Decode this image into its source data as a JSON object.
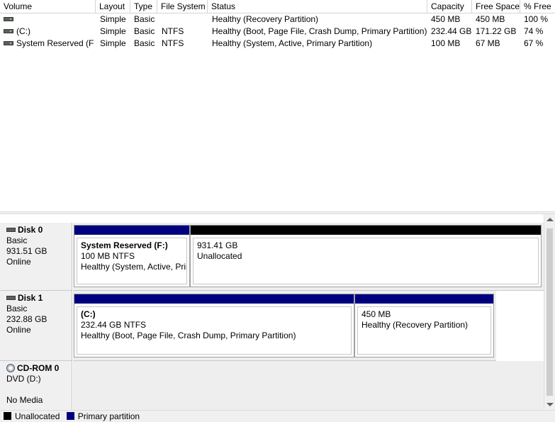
{
  "volume_list": {
    "columns": [
      "Volume",
      "Layout",
      "Type",
      "File System",
      "Status",
      "Capacity",
      "Free Space",
      "% Free"
    ],
    "rows": [
      {
        "volume": "",
        "layout": "Simple",
        "type": "Basic",
        "fs": "",
        "status": "Healthy (Recovery Partition)",
        "capacity": "450 MB",
        "free": "450 MB",
        "pct": "100 %"
      },
      {
        "volume": "(C:)",
        "layout": "Simple",
        "type": "Basic",
        "fs": "NTFS",
        "status": "Healthy (Boot, Page File, Crash Dump, Primary Partition)",
        "capacity": "232.44 GB",
        "free": "171.22 GB",
        "pct": "74 %"
      },
      {
        "volume": "System Reserved (F:)",
        "layout": "Simple",
        "type": "Basic",
        "fs": "NTFS",
        "status": "Healthy (System, Active, Primary Partition)",
        "capacity": "100 MB",
        "free": "67 MB",
        "pct": "67 %"
      }
    ]
  },
  "disks": [
    {
      "name": "Disk 0",
      "kind": "Basic",
      "size": "931.51 GB",
      "state": "Online",
      "partitions": [
        {
          "title": "System Reserved  (F:)",
          "size_fs": "100 MB NTFS",
          "status": "Healthy (System, Active, Primary Partition)",
          "type": "primary"
        },
        {
          "title": "",
          "size_fs": "931.41 GB",
          "status": "Unallocated",
          "type": "unallocated"
        }
      ]
    },
    {
      "name": "Disk 1",
      "kind": "Basic",
      "size": "232.88 GB",
      "state": "Online",
      "partitions": [
        {
          "title": "(C:)",
          "size_fs": "232.44 GB NTFS",
          "status": "Healthy (Boot, Page File, Crash Dump, Primary Partition)",
          "type": "primary"
        },
        {
          "title": "",
          "size_fs": "450 MB",
          "status": "Healthy (Recovery Partition)",
          "type": "primary"
        }
      ]
    },
    {
      "name": "CD-ROM 0",
      "kind": "DVD (D:)",
      "size": "",
      "state": "No Media",
      "partitions": []
    }
  ],
  "legend": {
    "unallocated": "Unallocated",
    "primary": "Primary partition"
  },
  "colors": {
    "unallocated": "#000000",
    "primary": "#00007f"
  },
  "icons": {
    "volume": "drive-icon",
    "disk": "disk-icon",
    "cdrom": "cd-icon"
  }
}
